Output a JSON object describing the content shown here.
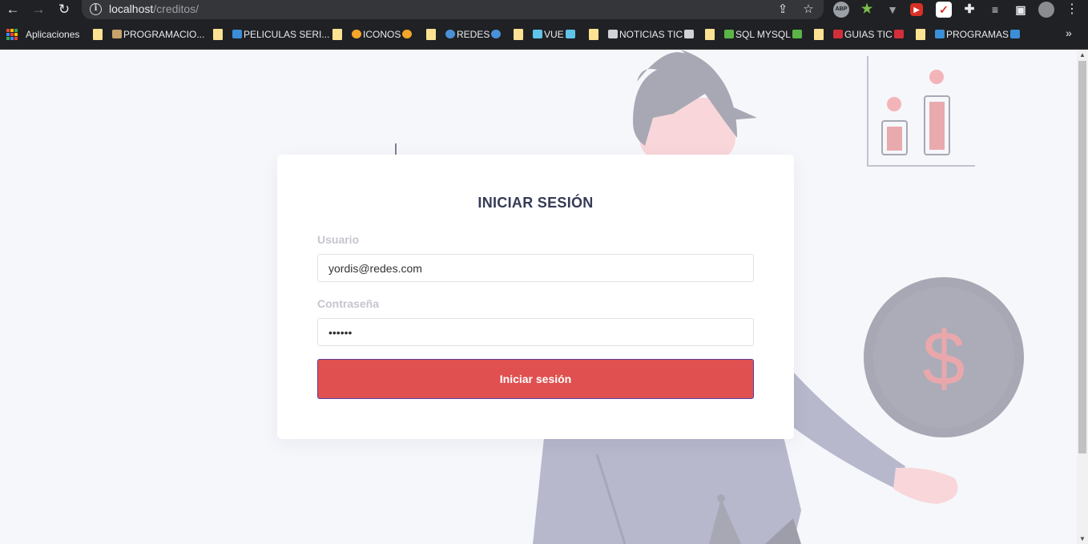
{
  "browser": {
    "url_host": "localhost",
    "url_path": "/creditos/",
    "bookmarks": [
      {
        "label": "Aplicaciones"
      },
      {
        "label": "PROGRAMACIO..."
      },
      {
        "label": "PELICULAS SERI..."
      },
      {
        "label": "ICONOS"
      },
      {
        "label": "REDES"
      },
      {
        "label": "VUE"
      },
      {
        "label": "NOTICIAS TIC"
      },
      {
        "label": "SQL MYSQL"
      },
      {
        "label": "GUIAS TIC"
      },
      {
        "label": "PROGRAMAS"
      }
    ],
    "extensions": [
      "abp-icon",
      "star-extension-icon",
      "vue-devtools-icon",
      "media-extension-icon",
      "checklist-icon",
      "puzzle-icon",
      "media-queue-icon",
      "sidebar-icon",
      "profile-avatar-icon"
    ]
  },
  "login": {
    "title": "INICIAR SESIÓN",
    "user_label": "Usuario",
    "user_value": "yordis@redes.com",
    "password_label": "Contraseña",
    "password_value": "••••••",
    "submit_label": "Iniciar sesión"
  },
  "illustration": {
    "coin_symbol": "$"
  },
  "colors": {
    "primary_button": "#e05050",
    "button_border": "#5b3fa0",
    "title": "#353b56",
    "label": "#c4c6d0",
    "accent_pink": "#ecaaad",
    "figure_gray": "#a7a8b4"
  }
}
